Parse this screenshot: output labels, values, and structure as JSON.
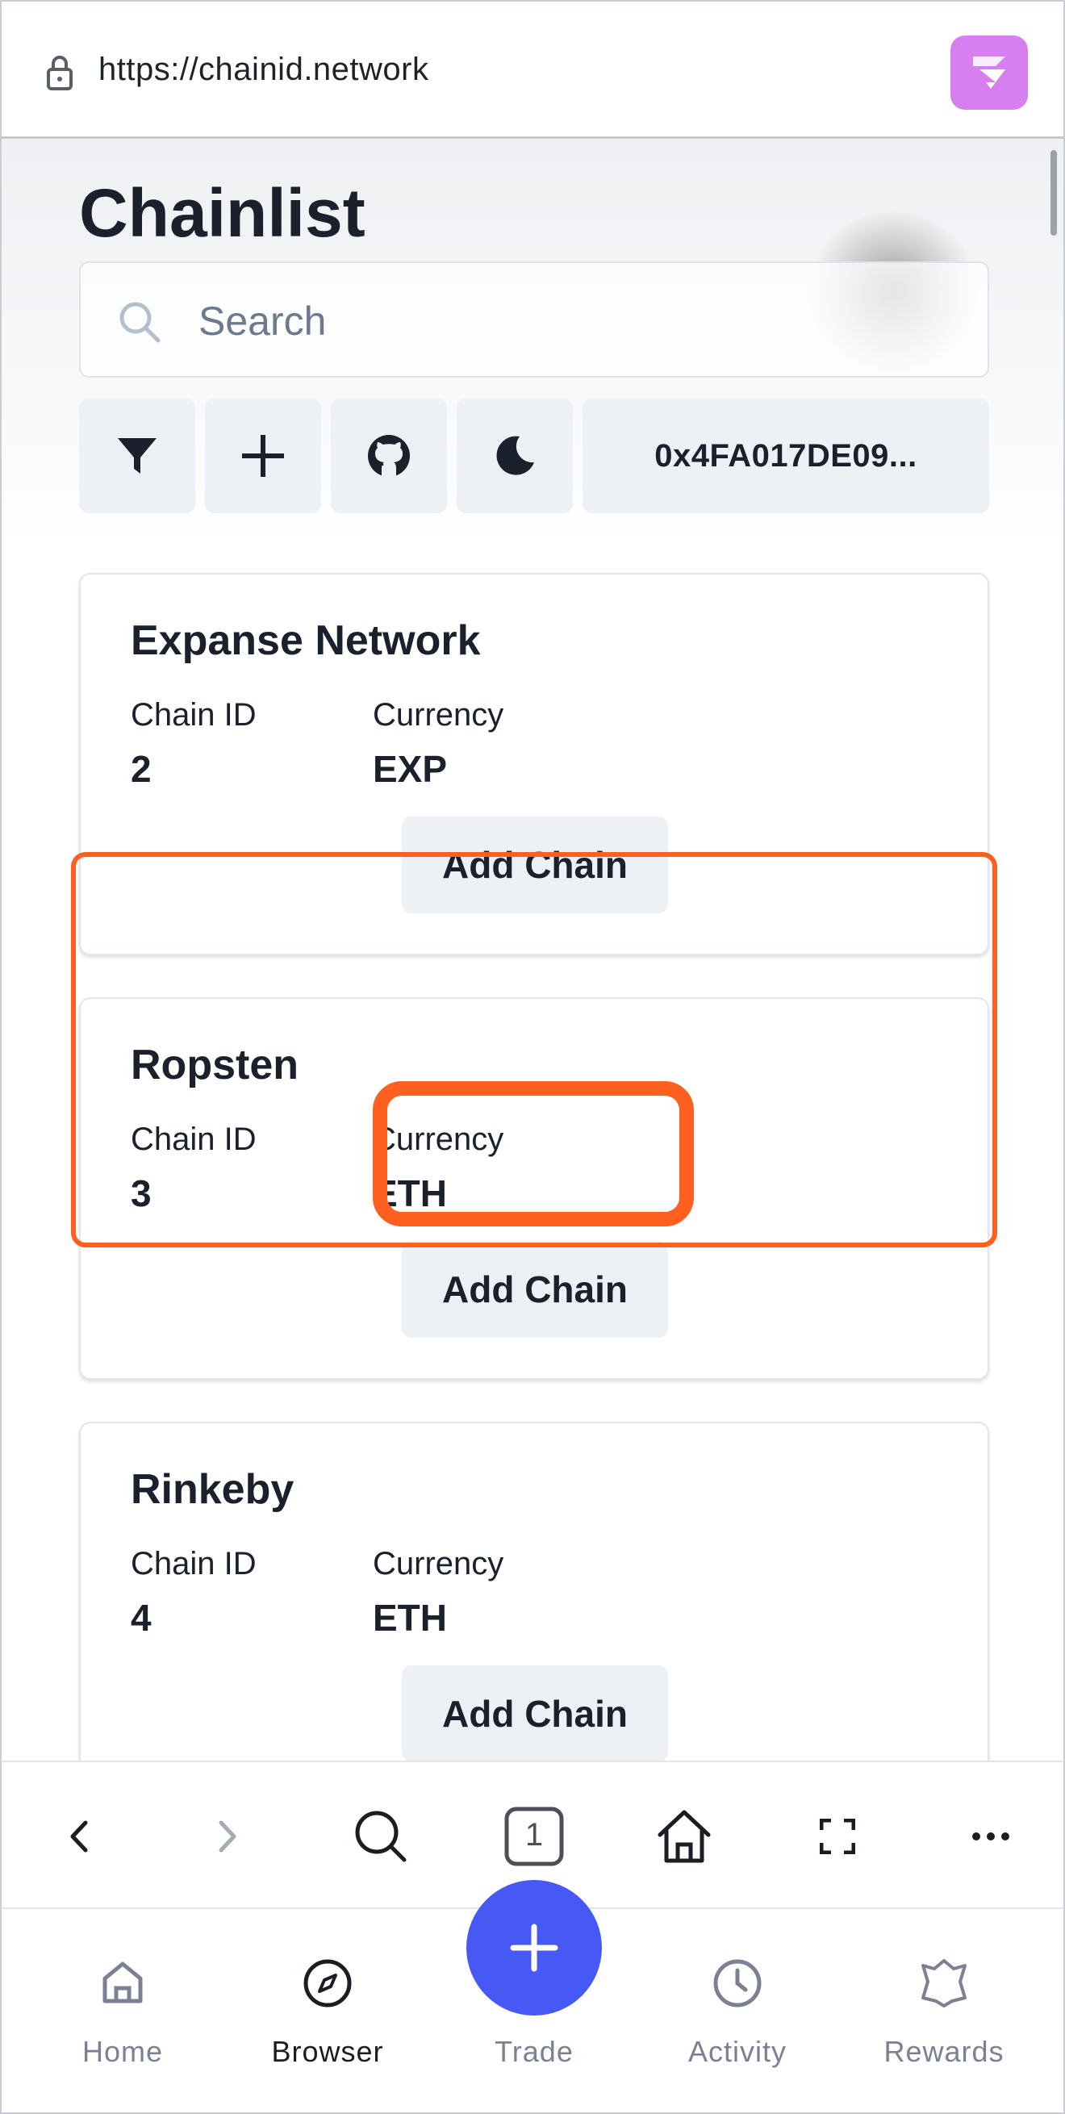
{
  "browser": {
    "url": "https://chainid.network"
  },
  "page": {
    "title": "Chainlist",
    "search": {
      "placeholder": "Search",
      "value": ""
    },
    "toolbar": {
      "filter_icon": "filter-icon",
      "add_icon": "plus-icon",
      "github_icon": "github-icon",
      "theme_icon": "moon-icon",
      "address": "0x4FA017DE09..."
    },
    "cards": [
      {
        "name": "Expanse Network",
        "chain_id_label": "Chain ID",
        "chain_id": "2",
        "currency_label": "Currency",
        "currency": "EXP",
        "button": "Add Chain"
      },
      {
        "name": "Ropsten",
        "chain_id_label": "Chain ID",
        "chain_id": "3",
        "currency_label": "Currency",
        "currency": "ETH",
        "button": "Add Chain"
      },
      {
        "name": "Rinkeby",
        "chain_id_label": "Chain ID",
        "chain_id": "4",
        "currency_label": "Currency",
        "currency": "ETH",
        "button": "Add Chain"
      }
    ],
    "highlight_color": "#ff5f1f"
  },
  "browser_toolbar": {
    "tab_count": "1",
    "icons": [
      "back-icon",
      "forward-icon",
      "search-icon",
      "tabs-icon",
      "home-icon",
      "fullscreen-icon",
      "more-icon"
    ]
  },
  "tabbar": {
    "items": [
      {
        "label": "Home",
        "icon": "home-icon"
      },
      {
        "label": "Browser",
        "icon": "compass-icon"
      },
      {
        "label": "Trade",
        "icon": "plus-icon"
      },
      {
        "label": "Activity",
        "icon": "clock-icon"
      },
      {
        "label": "Rewards",
        "icon": "rewards-icon"
      }
    ],
    "active": "Browser",
    "accent": "#4759f5"
  }
}
